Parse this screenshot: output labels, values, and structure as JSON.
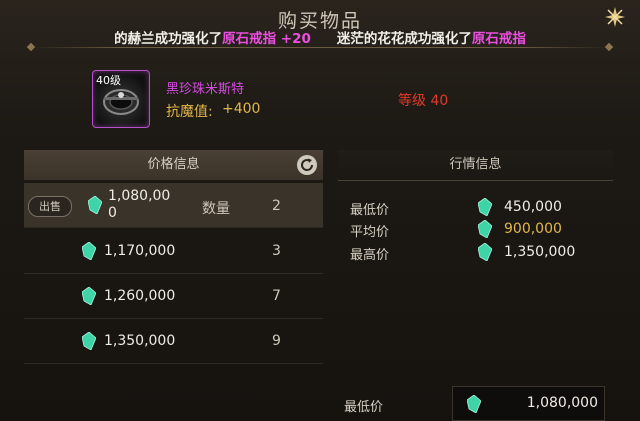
{
  "window": {
    "title": "购买物品",
    "close_icon": "close-star-icon"
  },
  "ticker": [
    {
      "prefix": "的赫兰成功强化了",
      "item": "原石戒指",
      "suffix": " +20"
    },
    {
      "prefix": "迷茫的花花成功强化了",
      "item": "原石戒指",
      "suffix": ""
    }
  ],
  "item": {
    "level_badge": "40级",
    "name": "黑珍珠米斯特",
    "stat_label": "抗魔值:",
    "stat_value": "+400",
    "required_level": "等级 40",
    "icon": "ring-icon"
  },
  "price_panel": {
    "header": "价格信息",
    "refresh_icon": "refresh-icon",
    "sell_label": "出售",
    "quantity_label": "数量",
    "rows": [
      {
        "price_line1": "1,080,00",
        "price_line2": "0",
        "quantity": "2"
      },
      {
        "price": "1,170,000",
        "quantity": "3"
      },
      {
        "price": "1,260,000",
        "quantity": "7"
      },
      {
        "price": "1,350,000",
        "quantity": "9"
      }
    ]
  },
  "market_panel": {
    "header": "行情信息",
    "lowest_label": "最低价",
    "lowest_value": "450,000",
    "average_label": "平均价",
    "average_value": "900,000",
    "highest_label": "最高价",
    "highest_value": "1,350,000"
  },
  "bottom": {
    "lowest_label": "最低价",
    "lowest_value": "1,080,000"
  },
  "colors": {
    "highlight_item": "#ea4fe0",
    "item_name": "#d24ce0",
    "gold": "#e2b84a",
    "required_level": "#e23a2a",
    "gem": "#3fd4a8"
  }
}
